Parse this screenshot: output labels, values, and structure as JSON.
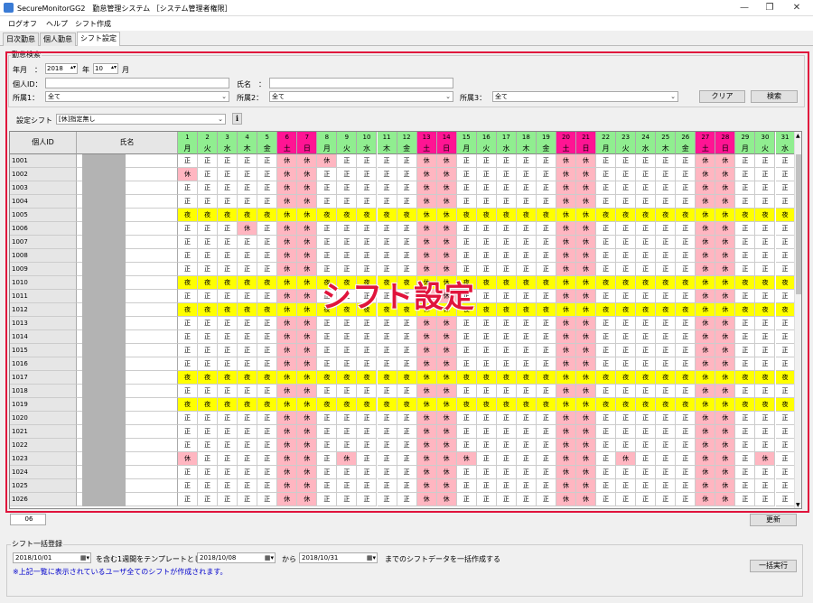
{
  "window": {
    "title": "SecureMonitorGG2　勤怠管理システム ［システム管理者権限］",
    "minimize": "—",
    "maximize": "❐",
    "close": "✕"
  },
  "menu": [
    "ログオフ",
    "ヘルプ",
    "シフト作成"
  ],
  "tabs": [
    "日次勤怠",
    "個人勤怠",
    "シフト設定"
  ],
  "overlay_text": "シフト設定",
  "search": {
    "group_title": "勤怠検索",
    "year_label": "年月　：",
    "year_value": "2018",
    "year_unit": "年",
    "month_value": "10",
    "month_unit": "月",
    "personal_id_label": "個人ID：",
    "name_label": "氏名　：",
    "dept1_label": "所属1：",
    "dept1_value": "全て",
    "dept2_label": "所属2：",
    "dept2_value": "全て",
    "dept3_label": "所属3：",
    "dept3_value": "全て",
    "clear_button": "クリア",
    "search_button": "検索",
    "shift_label": "設定シフト",
    "shift_value": "[休]指定無し",
    "info_icon": "i"
  },
  "grid": {
    "header_id": "個人ID",
    "header_name": "氏名",
    "days": [
      "1",
      "2",
      "3",
      "4",
      "5",
      "6",
      "7",
      "8",
      "9",
      "10",
      "11",
      "12",
      "13",
      "14",
      "15",
      "16",
      "17",
      "18",
      "19",
      "20",
      "21",
      "22",
      "23",
      "24",
      "25",
      "26",
      "27",
      "28",
      "29",
      "30",
      "31"
    ],
    "weekdays": [
      "月",
      "火",
      "水",
      "木",
      "金",
      "土",
      "日",
      "月",
      "火",
      "水",
      "木",
      "金",
      "土",
      "日",
      "月",
      "火",
      "水",
      "木",
      "金",
      "土",
      "日",
      "月",
      "火",
      "水",
      "木",
      "金",
      "土",
      "日",
      "月",
      "火",
      "水"
    ],
    "ids": [
      "1001",
      "1002",
      "1003",
      "1004",
      "1005",
      "1006",
      "1007",
      "1008",
      "1009",
      "1010",
      "1011",
      "1012",
      "1013",
      "1014",
      "1015",
      "1016",
      "1017",
      "1018",
      "1019",
      "1020",
      "1021",
      "1022",
      "1023",
      "1024",
      "1025",
      "1026"
    ],
    "values": {
      "work": "正",
      "off": "休",
      "night": "夜"
    },
    "yellow_rows": [
      "1005",
      "1010",
      "1012",
      "1017",
      "1019"
    ],
    "colors": {
      "weekday_header": "#90ee90",
      "weekend_header": "#ff1493",
      "weekend_cell": "#ffb6c1",
      "yellow_row": "#ffff00",
      "pink_cell": "#ffb6c1"
    }
  },
  "footer": {
    "count": "06",
    "update_button": "更新"
  },
  "bulk": {
    "group_title": "シフト一括登録",
    "date1": "2018/10/01",
    "mid_text": "を含む1週間をテンプレートとして",
    "date2": "2018/10/08",
    "from_text": "から",
    "date3": "2018/10/31",
    "until_text": "までのシフトデータを一括作成する",
    "note": "※上記一覧に表示されているユーザ全てのシフトが作成されます。",
    "run_button": "一括実行"
  }
}
